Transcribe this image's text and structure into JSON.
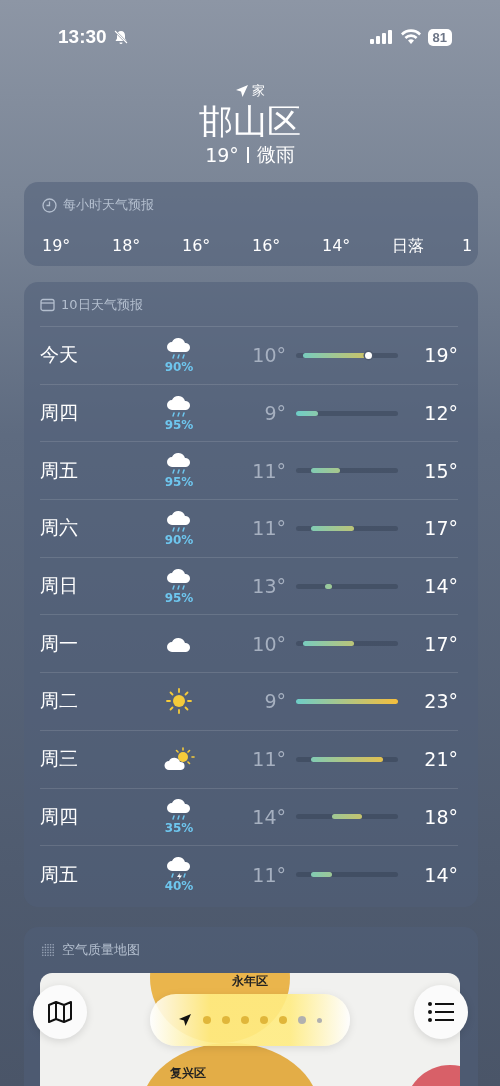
{
  "status_bar": {
    "time": "13:30",
    "silent": true,
    "battery": "81"
  },
  "header": {
    "place_label": "家",
    "city": "邯山区",
    "temp": "19°",
    "condition": "微雨"
  },
  "hourly": {
    "title": "每小时天气预报",
    "items": [
      "19°",
      "18°",
      "16°",
      "16°",
      "14°",
      "日落",
      "1"
    ]
  },
  "daily": {
    "title": "10日天气预报",
    "rows": [
      {
        "day": "今天",
        "kind": "rain",
        "chance": "90%",
        "low": "10°",
        "high": "19°",
        "now_dot": true
      },
      {
        "day": "周四",
        "kind": "rain",
        "chance": "95%",
        "low": "9°",
        "high": "12°",
        "now_dot": false
      },
      {
        "day": "周五",
        "kind": "rain",
        "chance": "95%",
        "low": "11°",
        "high": "15°",
        "now_dot": false
      },
      {
        "day": "周六",
        "kind": "rain",
        "chance": "90%",
        "low": "11°",
        "high": "17°",
        "now_dot": false
      },
      {
        "day": "周日",
        "kind": "rain",
        "chance": "95%",
        "low": "13°",
        "high": "14°",
        "now_dot": false
      },
      {
        "day": "周一",
        "kind": "cloud",
        "low": "10°",
        "high": "17°",
        "now_dot": false
      },
      {
        "day": "周二",
        "kind": "sun",
        "low": "9°",
        "high": "23°",
        "now_dot": false
      },
      {
        "day": "周三",
        "kind": "partly_sunny",
        "low": "11°",
        "high": "21°",
        "now_dot": false
      },
      {
        "day": "周四",
        "kind": "rain",
        "chance": "35%",
        "low": "14°",
        "high": "18°",
        "now_dot": false
      },
      {
        "day": "周五",
        "kind": "thunder_rain",
        "chance": "40%",
        "low": "11°",
        "high": "14°",
        "now_dot": false
      }
    ]
  },
  "air_quality": {
    "title": "空气质量地图",
    "map_labels": [
      "永年区",
      "复兴区"
    ]
  },
  "page_indicator": [
    {
      "kind": "location",
      "selected": true
    },
    {
      "kind": "dot",
      "selected": false
    },
    {
      "kind": "dot",
      "selected": false
    },
    {
      "kind": "dot",
      "selected": false
    },
    {
      "kind": "dot",
      "selected": false
    },
    {
      "kind": "dot",
      "selected": false
    },
    {
      "kind": "dot",
      "selected": false
    },
    {
      "kind": "small",
      "selected": false
    }
  ]
}
